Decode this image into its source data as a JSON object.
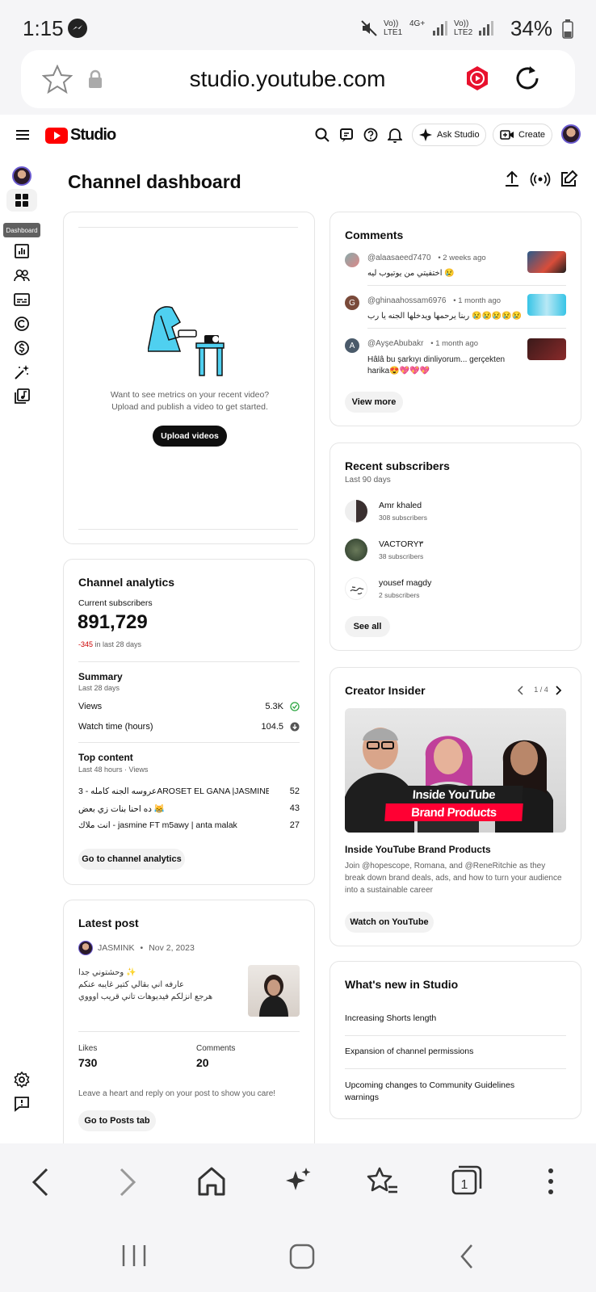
{
  "status": {
    "time": "1:15",
    "lte1": "Vo)) LTE1",
    "net": "4G+",
    "lte2": "Vo)) LTE2",
    "battery": "34%"
  },
  "browser": {
    "url": "studio.youtube.com"
  },
  "header": {
    "logo_text": "Studio",
    "ask_studio": "Ask Studio",
    "create": "Create"
  },
  "sidebar": {
    "tooltip": "Dashboard"
  },
  "page": {
    "title": "Channel dashboard"
  },
  "video_card": {
    "prompt_line1": "Want to see metrics on your recent video?",
    "prompt_line2": "Upload and publish a video to get started.",
    "upload_button": "Upload videos"
  },
  "analytics": {
    "title": "Channel analytics",
    "subs_label": "Current subscribers",
    "subs_value": "891,729",
    "change_value": "-345",
    "change_suffix": " in last 28 days",
    "summary_title": "Summary",
    "summary_sub": "Last 28 days",
    "views_label": "Views",
    "views_value": "5.3K",
    "watch_label": "Watch time (hours)",
    "watch_value": "104.5",
    "top_title": "Top content",
    "top_sub": "Last 48 hours · Views",
    "top_items": [
      {
        "title": "عروسه الجنه كامله - 3AROSET EL GANA |JASMINE EBRA...",
        "value": "52"
      },
      {
        "title": "ده احنا بنات زي بعض 😹",
        "value": "43"
      },
      {
        "title": "انت ملاك - jasmine FT m5awy | anta malak",
        "value": "27"
      }
    ],
    "button": "Go to channel analytics"
  },
  "latest_post": {
    "title": "Latest post",
    "author": "JASMINK",
    "date": "Nov 2, 2023",
    "line1": "✨ وحشتوني جدا",
    "line2": "عارفه اني بقالي كتير غايبه عنكم",
    "line3": "هرجع انزلكم فيديوهات تاني قريب اوووي",
    "likes_label": "Likes",
    "likes_value": "730",
    "comments_label": "Comments",
    "comments_value": "20",
    "footer": "Leave a heart and reply on your post to show you care!",
    "button": "Go to Posts tab"
  },
  "comments": {
    "title": "Comments",
    "items": [
      {
        "author": "@alaasaeed7470",
        "time": "• 2 weeks ago",
        "text": "اختفيتي من يوتيوب ليه 😢",
        "avatar_letter": ""
      },
      {
        "author": "@ghinaahossam6976",
        "time": "• 1 month ago",
        "text": "ربنا يرحمها ويدخلها الجنه يا رب 😢😢😢😢😢",
        "avatar_letter": "G"
      },
      {
        "author": "@AyşeAbubakr",
        "time": "• 1 month ago",
        "text": "Hâlâ bu şarkıyı dinliyorum... gerçekten harika😍💖💖💖",
        "avatar_letter": "A"
      }
    ],
    "button": "View more"
  },
  "subscribers": {
    "title": "Recent subscribers",
    "sub": "Last 90 days",
    "items": [
      {
        "name": "Amr khaled",
        "count": "308 subscribers"
      },
      {
        "name": "VACTORY٣",
        "count": "38 subscribers"
      },
      {
        "name": "yousef magdy",
        "count": "2 subscribers"
      }
    ],
    "button": "See all"
  },
  "creator_insider": {
    "title": "Creator Insider",
    "pager": "1 / 4",
    "banner_line1": "Inside YouTube",
    "banner_line2": "Brand Products",
    "video_title": "Inside YouTube Brand Products",
    "desc": "Join @hopescope, Romana, and @ReneRitchie as they break down brand deals, ads, and how to turn your audience into a sustainable career",
    "button": "Watch on YouTube"
  },
  "whats_new": {
    "title": "What's new in Studio",
    "items": [
      "Increasing Shorts length",
      "Expansion of channel permissions",
      "Upcoming changes to Community Guidelines warnings"
    ]
  },
  "colors": {
    "accent_red": "#ff0000",
    "negative": "#c00",
    "check_green": "#2ba640"
  }
}
